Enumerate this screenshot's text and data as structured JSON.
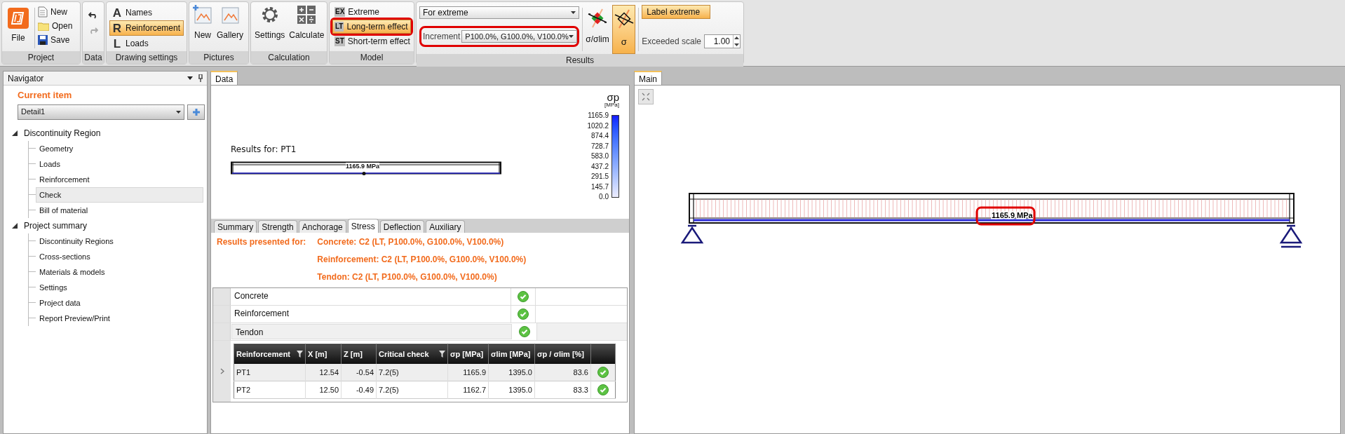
{
  "ribbon": {
    "project": {
      "label": "Project",
      "file": "File",
      "buttons": [
        "New",
        "Open",
        "Save"
      ]
    },
    "data": {
      "label": "Data"
    },
    "drawing_settings": {
      "label": "Drawing settings",
      "items": [
        {
          "letter": "A",
          "label": "Names",
          "selected": false
        },
        {
          "letter": "R",
          "label": "Reinforcement",
          "selected": true
        },
        {
          "letter": "L",
          "label": "Loads",
          "selected": false
        }
      ]
    },
    "pictures": {
      "label": "Pictures",
      "buttons": [
        "New",
        "Gallery"
      ]
    },
    "calculation": {
      "label": "Calculation",
      "buttons": [
        "Settings",
        "Calculate"
      ]
    },
    "model": {
      "label": "Model",
      "items": [
        {
          "code": "EX",
          "label": "Extreme",
          "selected": false,
          "highlighted": false
        },
        {
          "code": "LT",
          "label": "Long-term effect",
          "selected": true,
          "highlighted": true
        },
        {
          "code": "ST",
          "label": "Short-term effect",
          "selected": false,
          "highlighted": false
        }
      ]
    },
    "results": {
      "label": "Results",
      "mode": "For extreme",
      "increment_label": "Increment",
      "increment": "P100.0%, G100.0%, V100.0%",
      "increment_highlighted": true,
      "ratio_button": {
        "label": "σ/σlim",
        "selected": false
      },
      "stress_button": {
        "label": "σ",
        "selected": true
      },
      "label_extreme": {
        "label": "Label extreme",
        "selected": true
      },
      "scale_label": "Exceeded scale",
      "scale": "1.00"
    }
  },
  "navigator": {
    "title": "Navigator",
    "current_item_label": "Current item",
    "current_item": "Detail1",
    "tree": [
      {
        "label": "Discontinuity Region",
        "expanded": true,
        "children": [
          {
            "label": "Geometry",
            "selected": false
          },
          {
            "label": "Loads",
            "selected": false
          },
          {
            "label": "Reinforcement",
            "selected": false
          },
          {
            "label": "Check",
            "selected": true
          },
          {
            "label": "Bill of material",
            "selected": false
          }
        ]
      },
      {
        "label": "Project summary",
        "expanded": true,
        "children": [
          {
            "label": "Discontinuity Regions",
            "selected": false
          },
          {
            "label": "Cross-sections",
            "selected": false
          },
          {
            "label": "Materials & models",
            "selected": false
          },
          {
            "label": "Settings",
            "selected": false
          },
          {
            "label": "Project data",
            "selected": false
          },
          {
            "label": "Report Preview/Print",
            "selected": false
          }
        ]
      }
    ]
  },
  "data_panel": {
    "tab": "Data",
    "title": "Results for: PT1",
    "beam_label": "1165.9 MPa",
    "legend": {
      "title": "σp",
      "unit": "[MPa]",
      "ticks": [
        "1165.9",
        "1020.2",
        "874.4",
        "728.7",
        "583.0",
        "437.2",
        "291.5",
        "145.7",
        "0.0"
      ]
    },
    "result_tabs": [
      {
        "label": "Summary",
        "selected": false
      },
      {
        "label": "Strength",
        "selected": false
      },
      {
        "label": "Anchorage",
        "selected": false
      },
      {
        "label": "Stress",
        "selected": true
      },
      {
        "label": "Deflection",
        "selected": false
      },
      {
        "label": "Auxiliary",
        "selected": false
      }
    ],
    "results_for": {
      "label": "Results presented for:",
      "lines": [
        "Concrete: C2 (LT, P100.0%, G100.0%, V100.0%)",
        "Reinforcement: C2 (LT, P100.0%, G100.0%, V100.0%)",
        "Tendon: C2 (LT, P100.0%, G100.0%, V100.0%)"
      ]
    },
    "checks": [
      {
        "label": "Concrete",
        "ok": true,
        "expanded": false
      },
      {
        "label": "Reinforcement",
        "ok": true,
        "expanded": false
      },
      {
        "label": "Tendon",
        "ok": true,
        "expanded": true
      }
    ],
    "table": {
      "columns": [
        {
          "label": "Reinforcement",
          "filter": true
        },
        {
          "label": "X [m]",
          "filter": false
        },
        {
          "label": "Z [m]",
          "filter": false
        },
        {
          "label": "Critical check",
          "filter": true
        },
        {
          "label": "σp [MPa]",
          "filter": false
        },
        {
          "label": "σlim [MPa]",
          "filter": false
        },
        {
          "label": "σp / σlim [%]",
          "filter": false
        }
      ],
      "rows": [
        {
          "cells": [
            "PT1",
            "12.54",
            "-0.54",
            "7.2(5)",
            "1165.9",
            "1395.0",
            "83.6"
          ],
          "ok": true,
          "selected": true
        },
        {
          "cells": [
            "PT2",
            "12.50",
            "-0.49",
            "7.2(5)",
            "1162.7",
            "1395.0",
            "83.3"
          ],
          "ok": true,
          "selected": false
        }
      ]
    }
  },
  "main_panel": {
    "tab": "Main",
    "label": "1165.9 MPa",
    "label_highlighted": true
  }
}
